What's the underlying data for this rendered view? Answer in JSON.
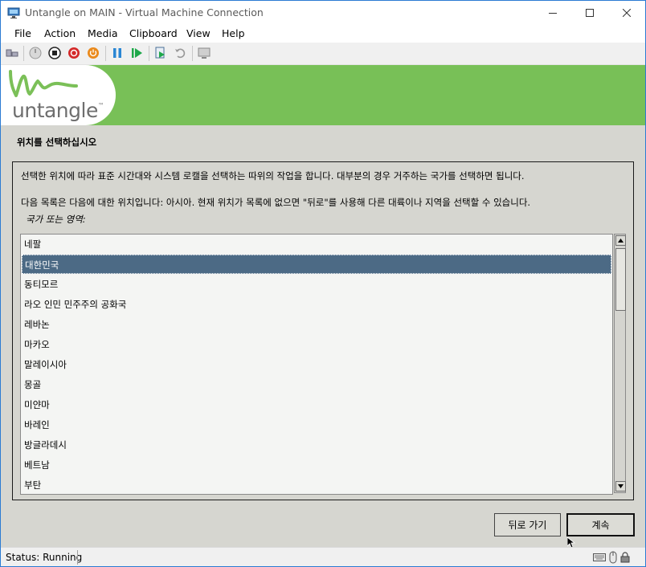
{
  "window": {
    "title": "Untangle on MAIN - Virtual Machine Connection"
  },
  "menu": [
    "File",
    "Action",
    "Media",
    "Clipboard",
    "View",
    "Help"
  ],
  "toolbar": {
    "icons": [
      "ctrl-alt-del-icon",
      "start-icon",
      "turn-off-icon",
      "shutdown-icon",
      "power-icon",
      "pause-icon",
      "resume-icon",
      "checkpoint-icon",
      "revert-icon",
      "enhanced-session-icon"
    ]
  },
  "logo": {
    "text": "untangle",
    "tm": "™"
  },
  "installer": {
    "heading": "위치를 선택하십시오",
    "description1": "선택한 위치에 따라 표준 시간대와 시스템 로캘을 선택하는 따위의 작업을 합니다. 대부분의 경우 거주하는 국가를 선택하면 됩니다.",
    "description2": "다음 목록은 다음에 대한 위치입니다: 아시아. 현재 위치가 목록에 없으면 \"뒤로\"를 사용해 다른 대륙이나 지역을 선택할 수 있습니다.",
    "field_label": "국가 또는 영역:",
    "countries": [
      "네팔",
      "대한민국",
      "동티모르",
      "라오 인민 민주주의 공화국",
      "레바논",
      "마카오",
      "말레이시아",
      "몽골",
      "미얀마",
      "바레인",
      "방글라데시",
      "베트남",
      "부탄"
    ],
    "selected": "대한민국",
    "back_label": "뒤로 가기",
    "continue_label": "계속"
  },
  "status": {
    "text": "Status: Running"
  },
  "colors": {
    "header_green": "#78c057",
    "selection": "#4c6a85",
    "background": "#d6d6d0"
  }
}
